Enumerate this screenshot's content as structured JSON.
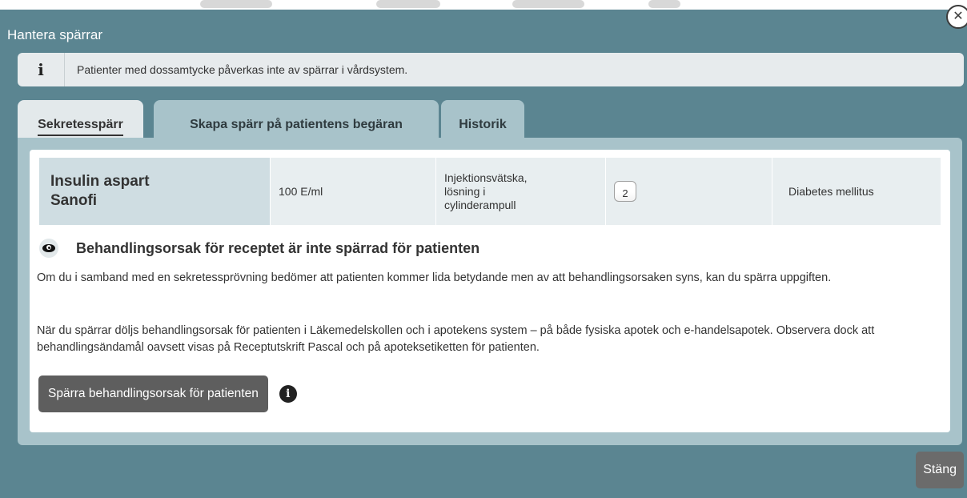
{
  "dialog": {
    "title": "Hantera spärrar",
    "close_icon": "close-icon"
  },
  "info_banner": {
    "icon": "info-icon",
    "icon_glyph": "i",
    "text": "Patienter med dossamtycke påverkas inte av spärrar i vårdsystem."
  },
  "tabs": [
    {
      "label": "Sekretesspärr",
      "active": true
    },
    {
      "label": "Skapa spärr på patientens begäran",
      "active": false
    },
    {
      "label": "Historik",
      "active": false
    }
  ],
  "drug": {
    "name_line1": "Insulin aspart",
    "name_line2": "Sanofi",
    "strength": "100 E/ml",
    "form_line1": "Injektionsvätska,",
    "form_line2": "lösning i",
    "form_line3": "cylinderampull",
    "count": "2",
    "indication": "Diabetes mellitus"
  },
  "status": {
    "icon": "eye-icon",
    "heading": "Behandlingsorsak för receptet är inte spärrad för patienten"
  },
  "paragraph1": "Om du i samband med en sekretessprövning bedömer att patienten kommer lida betydande men av att behandlingsorsaken syns, kan du spärra uppgiften.",
  "paragraph2": "När du spärrar döljs behandlingsorsak för patienten i Läkemedelskollen och i apotekens system – på både fysiska apotek och e-handelsapotek. Observera dock att behandlingsändamål oavsett visas på Receptutskrift Pascal och på apoteksetiketten för patienten.",
  "actions": {
    "block_button": "Spärra behandlingsorsak för patienten",
    "info_icon": "info-circle-icon",
    "info_glyph": "i",
    "close_button": "Stäng"
  },
  "colors": {
    "dialog_bg": "#5b8591",
    "tab_inactive": "#a8c3ca",
    "tab_active": "#e3e9eb",
    "button_dark": "#5e5e5e"
  }
}
